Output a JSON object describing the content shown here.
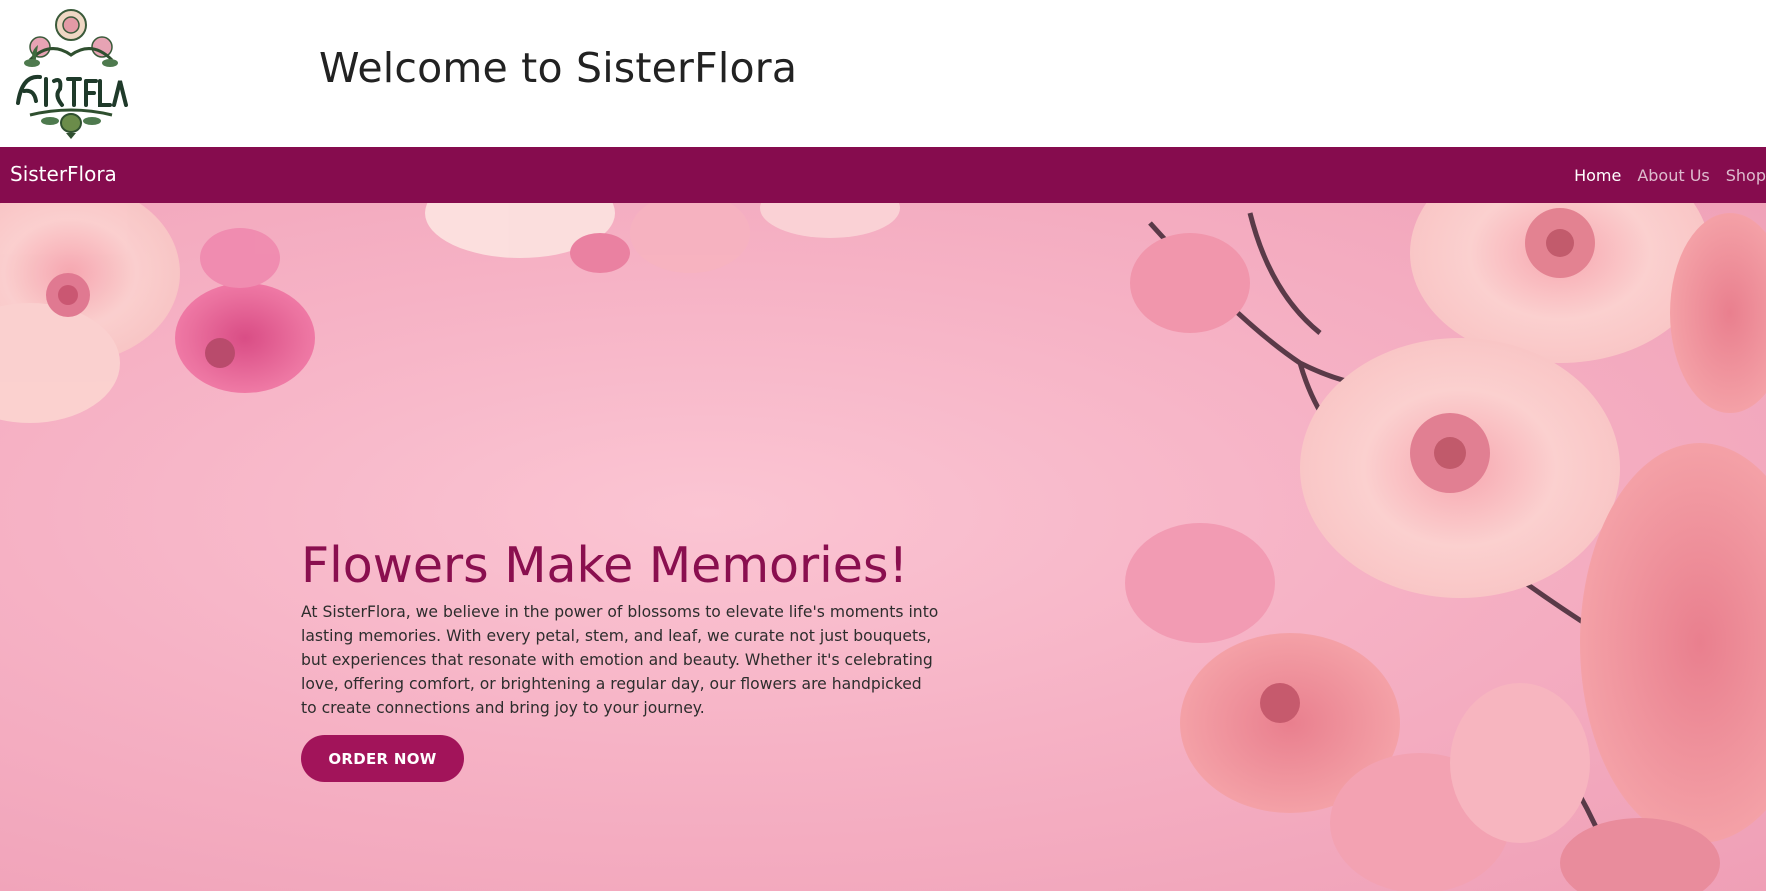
{
  "header": {
    "logo_alt": "SisterFlora",
    "title": "Welcome to SisterFlora"
  },
  "navbar": {
    "brand": "SisterFlora",
    "links": [
      {
        "label": "Home",
        "active": true
      },
      {
        "label": "About Us",
        "active": false
      },
      {
        "label": "Shop",
        "active": false
      }
    ]
  },
  "hero": {
    "title": "Flowers Make Memories!",
    "text": "At SisterFlora, we believe in the power of blossoms to elevate life's moments into lasting memories. With every petal, stem, and leaf, we curate not just bouquets, but experiences that resonate with emotion and beauty. Whether it's celebrating love, offering comfort, or brightening a regular day, our flowers are handpicked to create connections and bring joy to your journey.",
    "button_label": "ORDER NOW"
  },
  "colors": {
    "navbar": "#860c4e",
    "accent": "#8a0f4f",
    "button": "#a2145a",
    "hero_bg": "#f6b2c5"
  },
  "icons": {
    "logo": "sisterflora-logo"
  }
}
